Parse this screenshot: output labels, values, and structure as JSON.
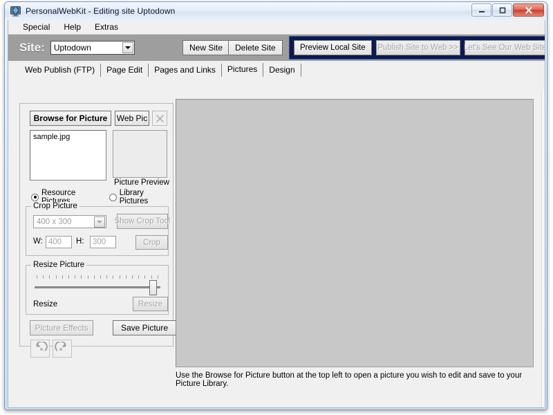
{
  "window": {
    "title": "PersonalWebKit - Editing site Uptodown",
    "icon": "globe-monitor-icon",
    "controls": {
      "minimize": "–",
      "maximize": "□",
      "close": "✕"
    }
  },
  "menubar": {
    "items": [
      {
        "label": "Special"
      },
      {
        "label": "Help"
      },
      {
        "label": "Extras"
      }
    ]
  },
  "toolbar": {
    "site_label": "Site:",
    "site_value": "Uptodown",
    "new_site": "New Site",
    "delete_site": "Delete Site",
    "actions": [
      {
        "label": "Preview Local Site",
        "enabled": true
      },
      {
        "label": "Publish Site to Web >>",
        "enabled": false
      },
      {
        "label": "Let's See Our Web Site",
        "enabled": false
      }
    ],
    "accent_color": "#0d1a4f"
  },
  "tabs": [
    {
      "label": "Web Publish (FTP)",
      "active": false
    },
    {
      "label": "Page Edit",
      "active": false
    },
    {
      "label": "Pages and Links",
      "active": false
    },
    {
      "label": "Pictures",
      "active": true
    },
    {
      "label": "Design",
      "active": false
    }
  ],
  "pictures_panel": {
    "browse_button": "Browse for Picture",
    "web_pic_button": "Web Pic",
    "clear_button": "✕",
    "file_list": [
      "sample.jpg"
    ],
    "preview_label": "Picture Preview",
    "source_options": [
      {
        "label": "Resource Pictures",
        "selected": true
      },
      {
        "label": "Library Pictures",
        "selected": false
      }
    ],
    "crop_group": {
      "title": "Crop Picture",
      "size_value": "400 x 300",
      "show_crop_tool": "Show Crop Tool",
      "width_label": "W:",
      "width_value": "400",
      "height_label": "H:",
      "height_value": "300",
      "crop_button": "Crop"
    },
    "resize_group": {
      "title": "Resize Picture",
      "slider_ticks": 20,
      "slider_position_percent": 100,
      "resize_label": "Resize",
      "resize_button": "Resize"
    },
    "effects_button": "Picture Effects",
    "save_button": "Save Picture",
    "rotate_ccw": "rotate-counter-clockwise-icon",
    "rotate_cw": "rotate-clockwise-icon"
  },
  "canvas": {
    "fill_color": "#c8c8c8",
    "hint": "Use the Browse for Picture button at the top left to open a picture you wish to edit and save to your Picture Library."
  }
}
